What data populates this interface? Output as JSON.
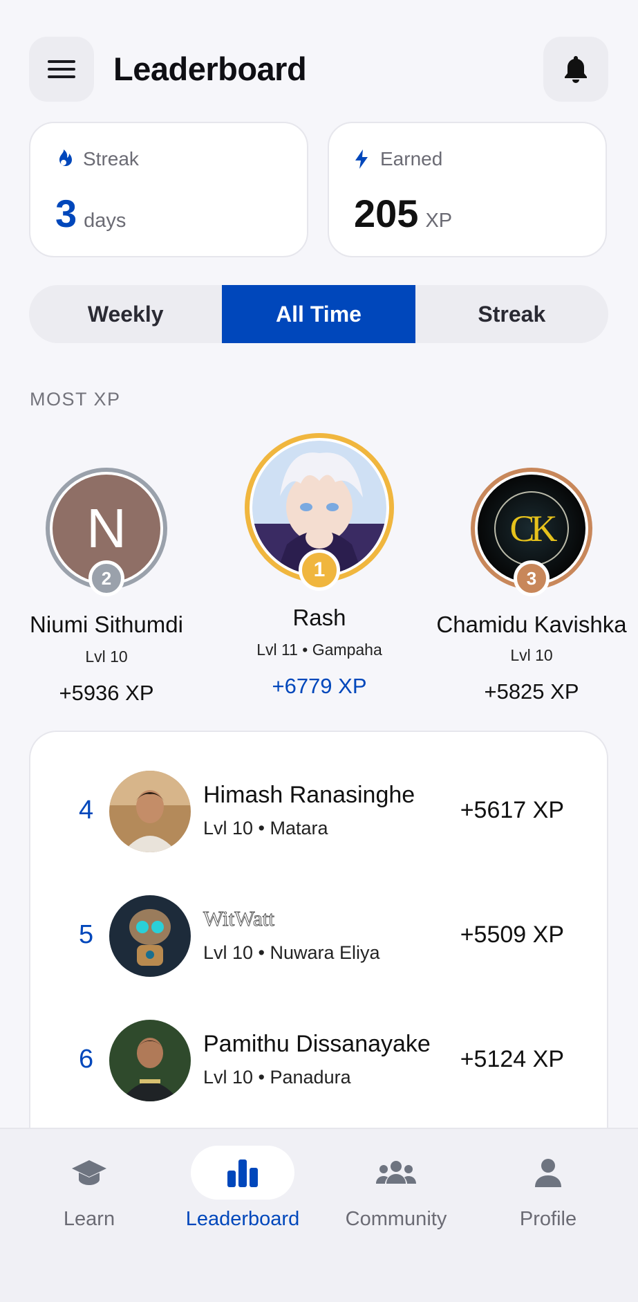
{
  "header": {
    "title": "Leaderboard",
    "menu_icon": "menu-icon",
    "bell_icon": "bell-icon"
  },
  "stats": {
    "streak": {
      "label": "Streak",
      "value": "3",
      "unit": "days",
      "icon": "flame-icon"
    },
    "earned": {
      "label": "Earned",
      "value": "205",
      "unit": "XP",
      "icon": "bolt-icon"
    }
  },
  "tabs": [
    {
      "label": "Weekly",
      "active": false
    },
    {
      "label": "All Time",
      "active": true
    },
    {
      "label": "Streak",
      "active": false
    }
  ],
  "section_label": "MOST XP",
  "podium": {
    "first": {
      "rank": "1",
      "name": "Rash",
      "sub": "Lvl 11 • Gampaha",
      "xp": "+6779 XP"
    },
    "second": {
      "rank": "2",
      "initial": "N",
      "name": "Niumi Sithumdi",
      "sub": "Lvl 10",
      "xp": "+5936 XP"
    },
    "third": {
      "rank": "3",
      "logo_text": "CK",
      "name": "Chamidu Kavishka",
      "sub": "Lvl 10",
      "xp": "+5825 XP"
    }
  },
  "list": [
    {
      "rank": "4",
      "name": "Himash Ranasinghe",
      "sub": "Lvl 10 • Matara",
      "xp": "+5617 XP"
    },
    {
      "rank": "5",
      "name": "WitWatt",
      "sub": "Lvl 10 • Nuwara Eliya",
      "xp": "+5509 XP"
    },
    {
      "rank": "6",
      "name": "Pamithu Dissanayake",
      "sub": "Lvl 10 • Panadura",
      "xp": "+5124 XP"
    }
  ],
  "nav": [
    {
      "label": "Learn",
      "icon": "graduation-cap-icon",
      "active": false
    },
    {
      "label": "Leaderboard",
      "icon": "bar-chart-icon",
      "active": true
    },
    {
      "label": "Community",
      "icon": "users-icon",
      "active": false
    },
    {
      "label": "Profile",
      "icon": "user-icon",
      "active": false
    }
  ],
  "colors": {
    "accent": "#0047bb",
    "gold": "#f0b63e",
    "silver": "#9aa1ab",
    "bronze": "#c8875a",
    "avatar_n_bg": "#8f6f66"
  }
}
